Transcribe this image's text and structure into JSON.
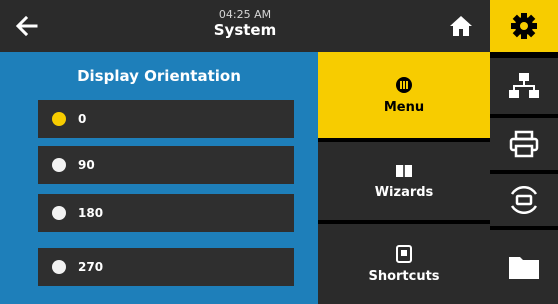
{
  "header": {
    "time": "04:25 AM",
    "title": "System"
  },
  "panel": {
    "title": "Display Orientation",
    "options": [
      {
        "label": "0",
        "selected": true
      },
      {
        "label": "90",
        "selected": false
      },
      {
        "label": "180",
        "selected": false
      },
      {
        "label": "270",
        "selected": false
      }
    ]
  },
  "nav": {
    "menu": "Menu",
    "wizards": "Wizards",
    "shortcuts": "Shortcuts"
  },
  "colors": {
    "accent": "#f7cc00",
    "panel": "#1e7fba",
    "tile": "#2b2b2b"
  },
  "icons": {
    "back": "arrow-left-icon",
    "home": "home-icon",
    "settings": "gear-icon",
    "network": "network-icon",
    "print": "printer-icon",
    "connect": "rfid-icon",
    "storage": "folder-icon",
    "menu": "menu-dots-icon",
    "wizards": "book-icon",
    "shortcuts": "shortcut-icon"
  }
}
